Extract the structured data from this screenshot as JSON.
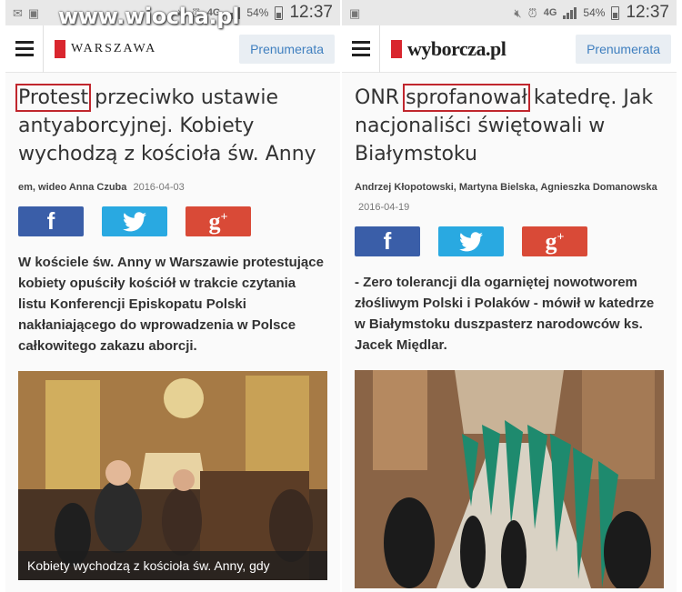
{
  "watermark": "www.wiocha.pl",
  "left": {
    "status": {
      "pct": "54%",
      "time": "12:37",
      "net": "4G"
    },
    "brand": "WARSZAWA",
    "subscribe": "Prenumerata",
    "headline_highlight": "Protest",
    "headline_rest": " przeciwko ustawie antyaborcyjnej. Kobiety wychodzą z kościoła św. Anny",
    "byline_authors": "em, wideo Anna Czuba",
    "byline_date": "2016-04-03",
    "lead": "W kościele św. Anny w Warszawie protestujące kobiety opuściły kościół w trakcie czytania listu Konferencji Episkopatu Polski nakłaniającego do wprowadzenia w Polsce całkowitego zakazu aborcji.",
    "photo_caption": "Kobiety wychodzą z kościoła św. Anny, gdy"
  },
  "right": {
    "status": {
      "pct": "54%",
      "time": "12:37",
      "net": "4G"
    },
    "brand": "wyborcza.pl",
    "subscribe": "Prenumerata",
    "headline_pre": "ONR ",
    "headline_highlight": "sprofanował",
    "headline_rest": " katedrę. Jak nacjonaliści świętowali w Białymstoku",
    "byline_authors": "Andrzej Kłopotowski, Martyna Bielska, Agnieszka Domanowska",
    "byline_date": "2016-04-19",
    "lead": "- Zero tolerancji dla ogarniętej nowotworem złośliwym Polski i Polaków - mówił w katedrze w Białymstoku duszpasterz narodowców ks. Jacek Międlar."
  },
  "icons": {
    "facebook": "facebook-icon",
    "twitter": "twitter-icon",
    "googleplus": "google-plus-icon",
    "menu": "hamburger-menu-icon"
  },
  "colors": {
    "highlight_box": "#c0262d",
    "facebook": "#3a5ea8",
    "twitter": "#29a9e1",
    "googleplus": "#d94a37",
    "subscribe_text": "#3f7fbf",
    "logo_red": "#d9262e"
  }
}
